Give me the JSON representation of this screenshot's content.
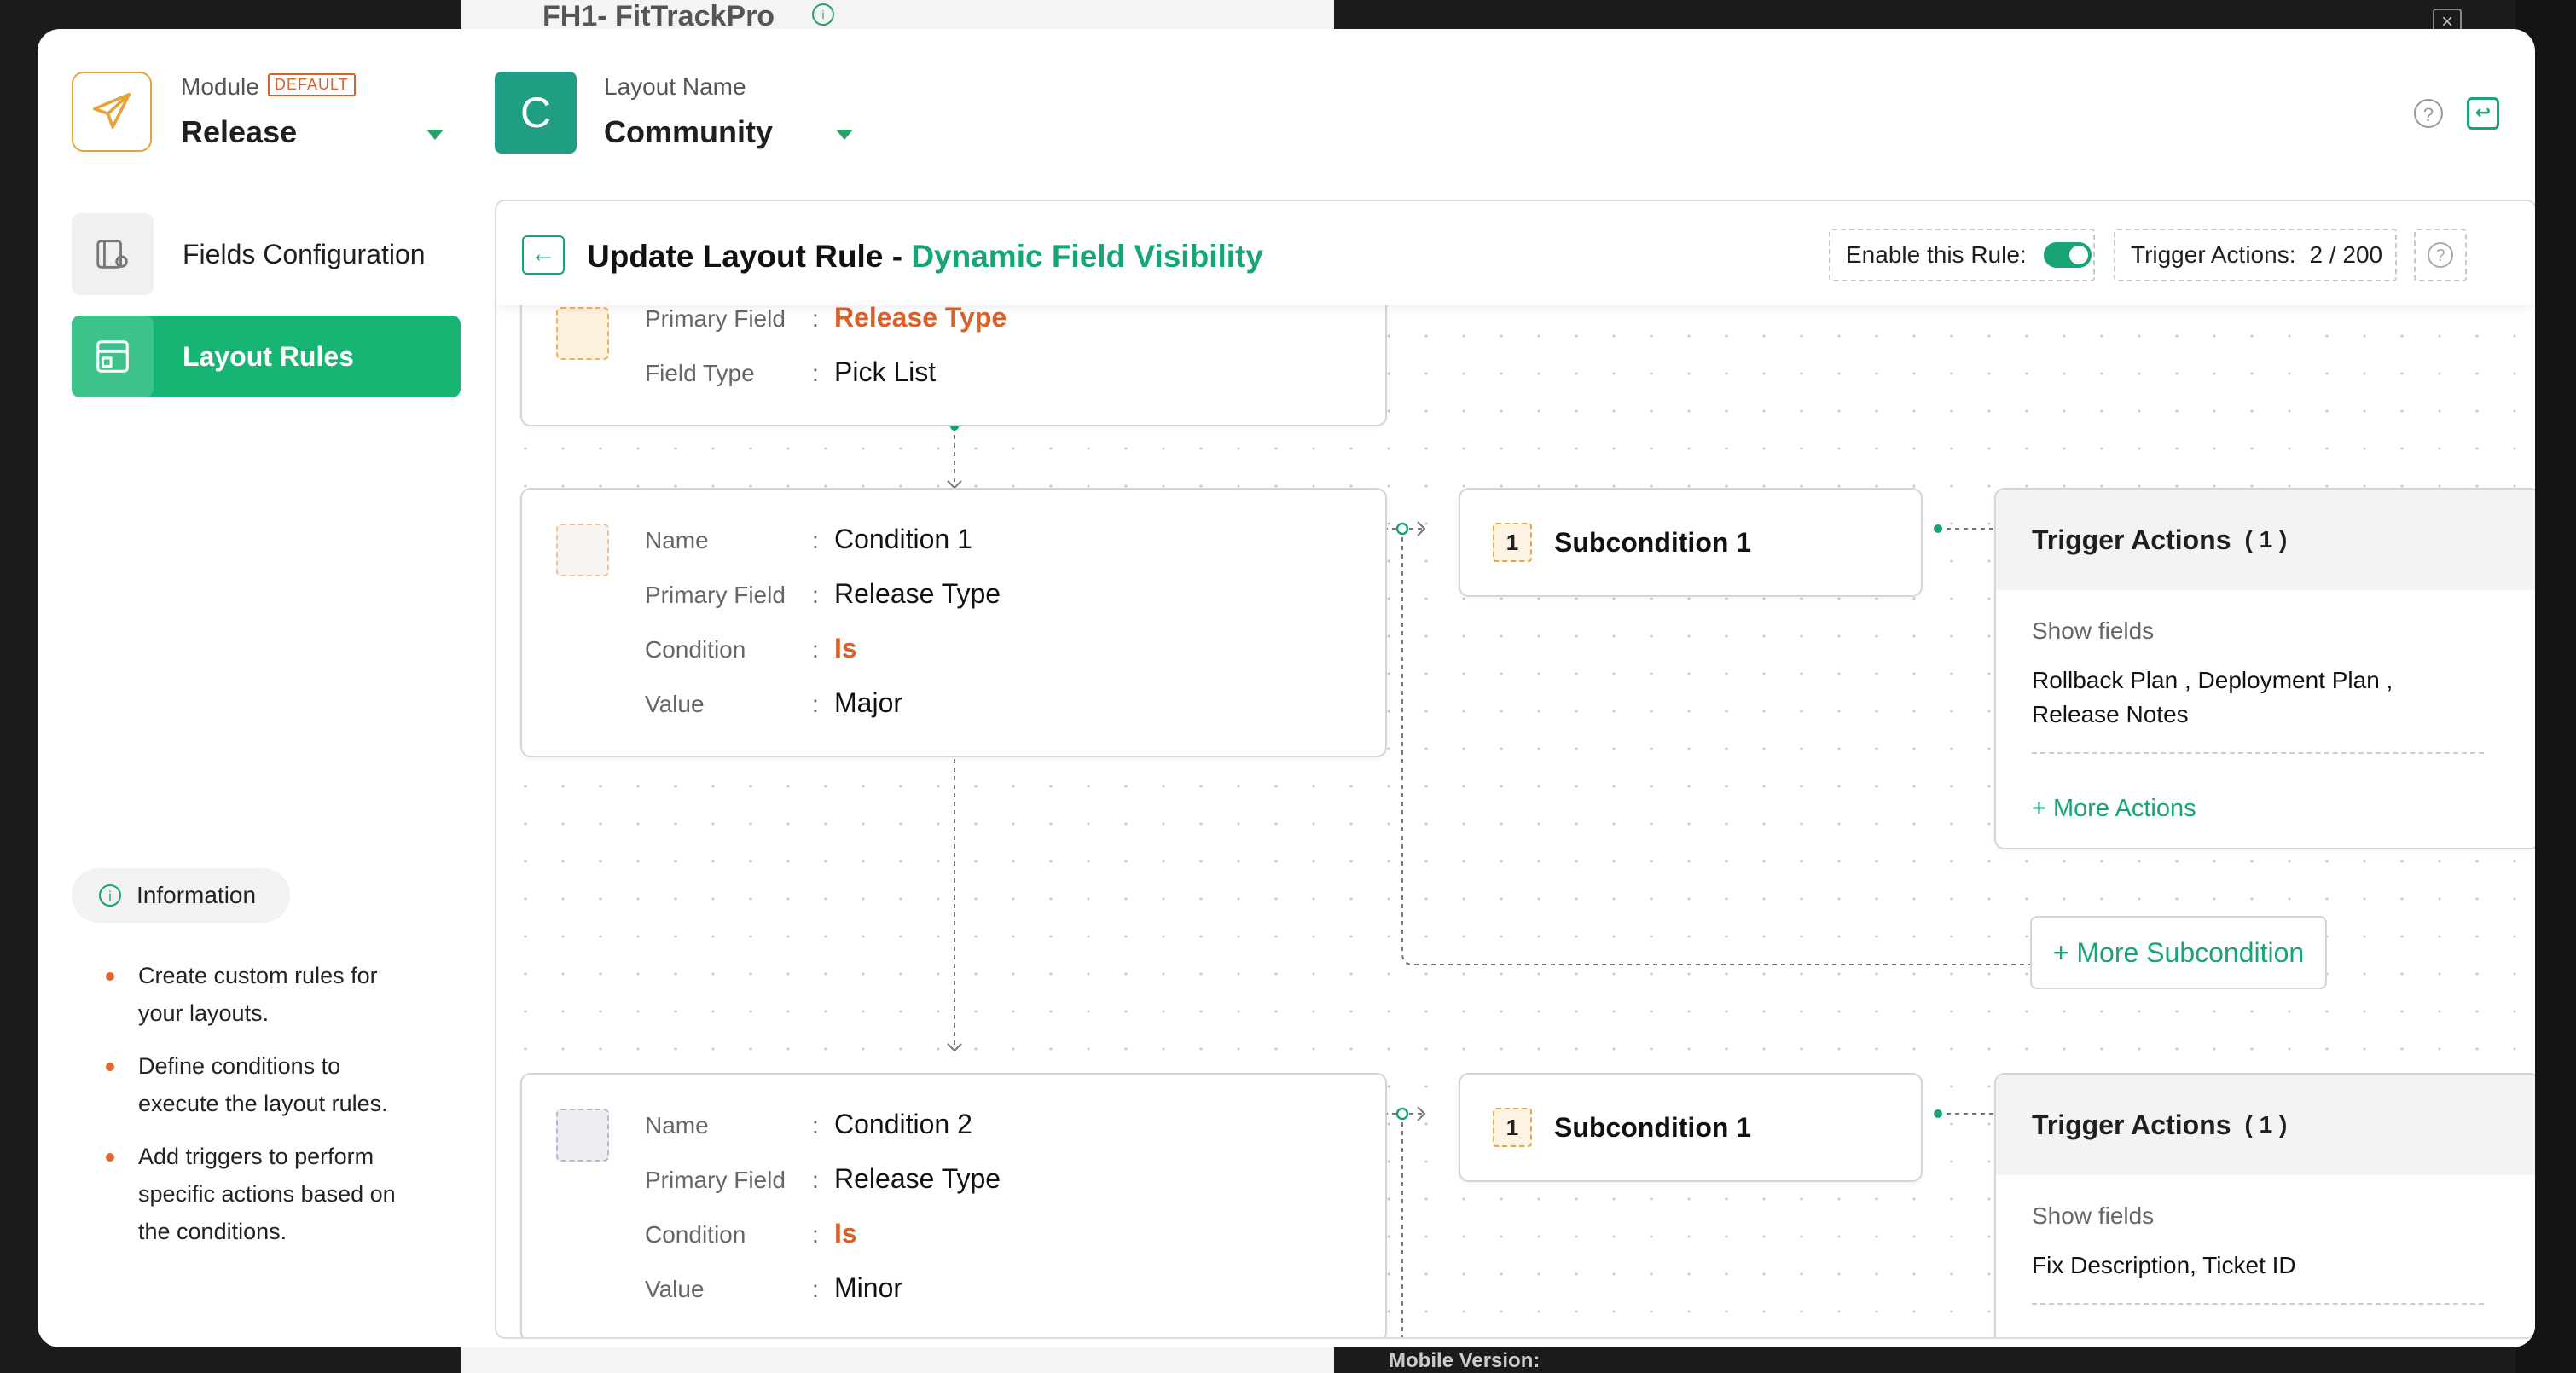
{
  "background": {
    "app_title": "FH1- FitTrackPro",
    "mobile_version": "Mobile Version:"
  },
  "header": {
    "module_label": "Module",
    "module_badge": "DEFAULT",
    "module_value": "Release",
    "layout_avatar_letter": "C",
    "layout_label": "Layout Name",
    "layout_value": "Community"
  },
  "sidebar": {
    "items": [
      {
        "label": "Fields Configuration",
        "active": false
      },
      {
        "label": "Layout Rules",
        "active": true
      }
    ],
    "info_title": "Information",
    "info_points": [
      "Create custom rules for your layouts.",
      "Define conditions to execute the layout rules.",
      "Add triggers to perform specific actions based on the conditions."
    ]
  },
  "rule": {
    "title_prefix": "Update Layout Rule - ",
    "title_name": "Dynamic Field Visibility",
    "enable_label": "Enable this Rule:",
    "enabled": true,
    "trigger_actions_label": "Trigger Actions:",
    "trigger_actions_count": "2 / 200"
  },
  "primary_card": {
    "rows": [
      {
        "key": "Primary Field",
        "value": "Release Type"
      },
      {
        "key": "Field Type",
        "value": "Pick List"
      }
    ]
  },
  "conditions": [
    {
      "rows": [
        {
          "key": "Name",
          "value": "Condition 1"
        },
        {
          "key": "Primary Field",
          "value": "Release Type"
        },
        {
          "key": "Condition",
          "value": "Is"
        },
        {
          "key": "Value",
          "value": "Major"
        }
      ],
      "subcondition": {
        "number": "1",
        "name": "Subcondition 1"
      },
      "trigger": {
        "title": "Trigger Actions",
        "count": "( 1 )",
        "label": "Show fields",
        "fields": "Rollback Plan , Deployment Plan , Release Notes",
        "more_actions": "+ More Actions"
      },
      "more_subcondition": "+ More Subcondition"
    },
    {
      "rows": [
        {
          "key": "Name",
          "value": "Condition 2"
        },
        {
          "key": "Primary Field",
          "value": "Release Type"
        },
        {
          "key": "Condition",
          "value": "Is"
        },
        {
          "key": "Value",
          "value": "Minor"
        }
      ],
      "subcondition": {
        "number": "1",
        "name": "Subcondition 1"
      },
      "trigger": {
        "title": "Trigger Actions",
        "count": "( 1 )",
        "label": "Show fields",
        "fields": "Fix Description, Ticket ID"
      }
    }
  ],
  "colors": {
    "accent_green": "#17a673",
    "highlight_orange": "#d8602b",
    "layout_avatar": "#1f9e83"
  }
}
